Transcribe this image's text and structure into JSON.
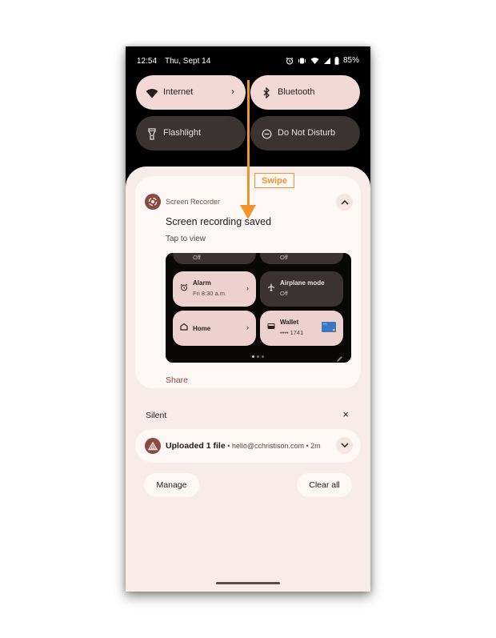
{
  "status_bar": {
    "time": "12:54",
    "date": "Thu, Sept 14",
    "battery": "85%",
    "icons": [
      "alarm-icon",
      "vibrate-icon",
      "wifi-icon",
      "cellular-icon",
      "battery-icon"
    ]
  },
  "quick_settings": {
    "tiles": [
      {
        "label": "Internet",
        "icon": "wifi-icon",
        "state": "on",
        "has_chevron": true
      },
      {
        "label": "Bluetooth",
        "icon": "bluetooth-icon",
        "state": "on",
        "has_chevron": false
      },
      {
        "label": "Flashlight",
        "icon": "flashlight-icon",
        "state": "off",
        "has_chevron": false
      },
      {
        "label": "Do Not Disturb",
        "icon": "do-not-disturb-icon",
        "state": "off",
        "has_chevron": false
      }
    ],
    "chevron": "›"
  },
  "annotation": {
    "label": "Swipe",
    "color": "#f0952b"
  },
  "notification": {
    "app_name": "Screen Recorder",
    "title": "Screen recording saved",
    "subtitle": "Tap to view",
    "action": "Share",
    "preview": {
      "top_row_partial": [
        "Off",
        "Off"
      ],
      "tiles": [
        {
          "label": "Alarm",
          "sub": "Fri 8:30 a.m.",
          "icon": "alarm-icon",
          "state": "on",
          "chevron": "›"
        },
        {
          "label": "Airplane mode",
          "sub": "Off",
          "icon": "airplane-icon",
          "state": "off"
        },
        {
          "label": "Home",
          "sub": "",
          "icon": "home-icon",
          "state": "on",
          "chevron": "›"
        },
        {
          "label": "Wallet",
          "sub": "•••• 1741",
          "icon": "wallet-icon",
          "state": "on"
        }
      ],
      "page_count": 3,
      "active_page": 1
    }
  },
  "silent_section": {
    "label": "Silent",
    "close": "×",
    "notification": {
      "title": "Uploaded 1 file",
      "meta": " • hello@cchristison.com • 2m"
    }
  },
  "footer": {
    "manage": "Manage",
    "clear_all": "Clear all"
  },
  "colors": {
    "accent": "#8b4a40",
    "tile_on": "#f3d9d6",
    "tile_off": "#3a3332",
    "shade_bg": "#f7ecea",
    "card_bg": "#fdf7f5"
  }
}
